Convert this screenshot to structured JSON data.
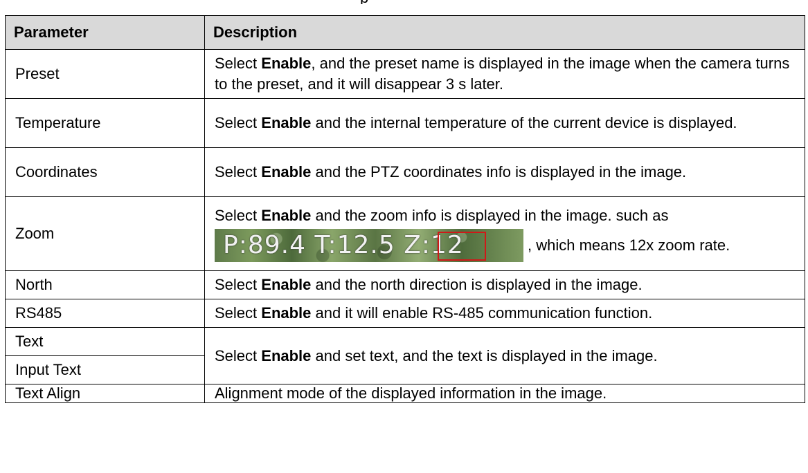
{
  "header_fragment": "p",
  "table": {
    "headers": {
      "parameter": "Parameter",
      "description": "Description"
    },
    "rows": {
      "preset": {
        "parameter": "Preset",
        "pre": "Select ",
        "bold": "Enable",
        "post": ", and the preset name is displayed in the image when the camera turns to the preset, and it will disappear 3 s later."
      },
      "temperature": {
        "parameter": "Temperature",
        "pre": "Select ",
        "bold": "Enable",
        "post": " and the internal temperature of the current device is displayed."
      },
      "coordinates": {
        "parameter": "Coordinates",
        "pre": "Select ",
        "bold": "Enable",
        "post": " and the PTZ coordinates info is displayed in the image."
      },
      "zoom": {
        "parameter": "Zoom",
        "pre": "Select ",
        "bold": "Enable",
        "post": " and the zoom info is displayed in the image. such as",
        "osd_text": "P:89.4 T:12.5 Z:12",
        "suffix": ", which means 12x zoom rate."
      },
      "north": {
        "parameter": "North",
        "pre": "Select ",
        "bold": "Enable",
        "post": " and the north direction is displayed in the image."
      },
      "rs485": {
        "parameter": "RS485",
        "pre": "Select ",
        "bold": "Enable",
        "post": " and it will enable RS-485 communication function."
      },
      "text": {
        "parameter": "Text",
        "pre": "Select ",
        "bold": "Enable",
        "post": " and set text, and the text is displayed in the image."
      },
      "input_text": {
        "parameter": "Input Text"
      },
      "text_align": {
        "parameter": "Text Align",
        "description": "Alignment mode of the displayed information in the image."
      }
    }
  }
}
